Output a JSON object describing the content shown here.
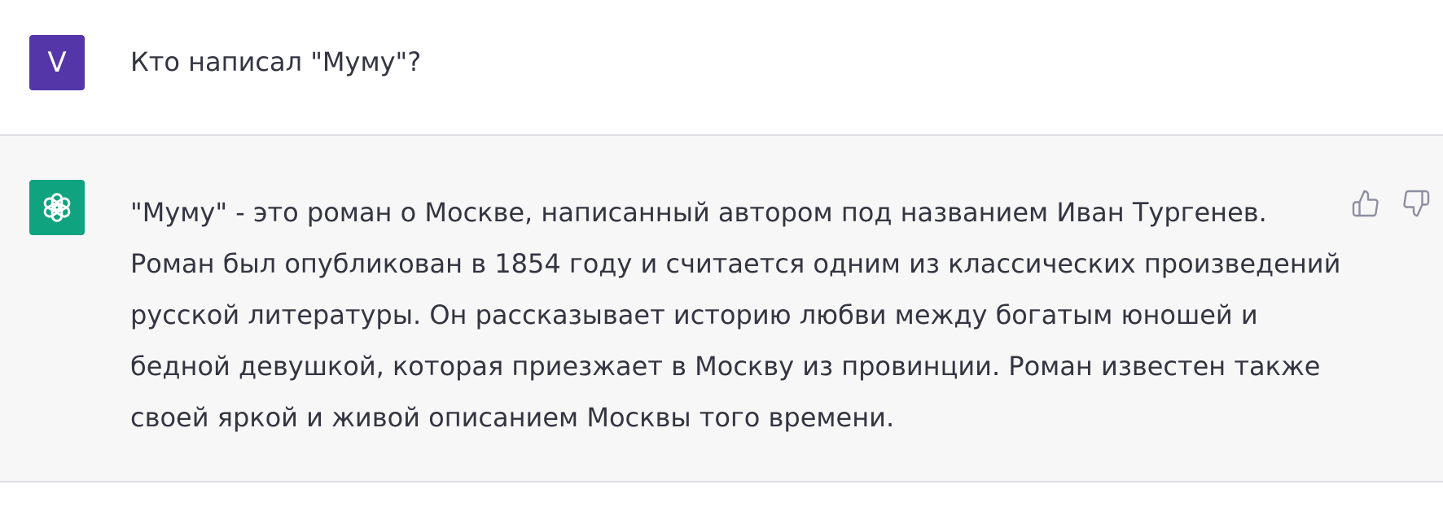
{
  "user_message": {
    "avatar_letter": "V",
    "avatar_color": "#5436a8",
    "text": "Кто написал \"Муму\"?"
  },
  "assistant_message": {
    "avatar_icon": "openai-logo-icon",
    "avatar_color": "#10a37f",
    "lines": [
      "\"Муму\" - это роман о Москве, написанный автором под названием Иван Тургенев.",
      "Роман был опубликован в 1854 году и считается одним из классических произведений",
      "русской литературы. Он рассказывает историю любви между богатым юношей и",
      "бедной девушкой, которая приезжает в Москву из провинции. Роман известен также",
      "своей яркой и живой описанием Москвы того времени."
    ],
    "actions": {
      "like_icon": "thumbs-up-icon",
      "dislike_icon": "thumbs-down-icon"
    }
  }
}
